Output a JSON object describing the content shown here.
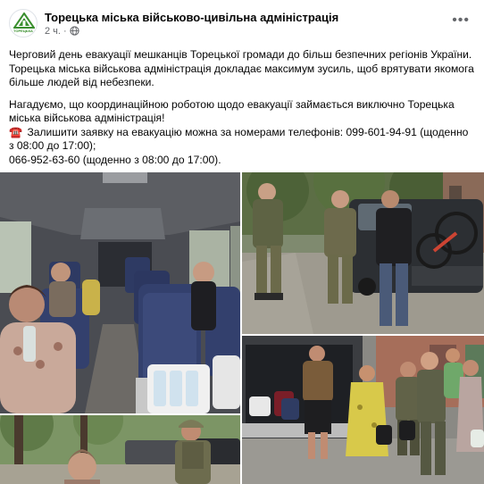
{
  "post": {
    "page_name": "Торецька міська військово-цивільна адміністрація",
    "timestamp": "2 ч.",
    "audience_icon": "globe-icon",
    "more_icon": "more-horizontal-icon",
    "avatar_logo_text": "ТОРЕЦЬКА"
  },
  "content": {
    "paragraph1": "Черговий день евакуації мешканців Торецької громади до більш безпечних регіонів України. Торецька міська військова адміністрація докладає максимум зусиль, щоб врятувати якомога більше людей від небезпеки.",
    "paragraph2_line1": "Нагадуємо, що координаційною роботою щодо евакуації займається виключно Торецька міська військова адміністрація!",
    "phone_emoji": "☎️",
    "paragraph2_line2": "Залишити заявку на евакуацію можна за номерами телефонів: 099-601-94-91 (щоденно з 08:00 до 17:00);",
    "paragraph2_line3": "066-952-63-60 (щоденно з 08:00 до 17:00)."
  },
  "photos": [
    {
      "subject": "bus-interior-evacuees"
    },
    {
      "subject": "soldiers-loading-van"
    },
    {
      "subject": "people-with-bags-near-van"
    },
    {
      "subject": "elderly-woman-and-soldier-outdoors"
    }
  ],
  "colors": {
    "text": "#050505",
    "secondary_text": "#65676b",
    "phone_icon": "#e02e2e",
    "logo_green": "#3a8f2e"
  }
}
